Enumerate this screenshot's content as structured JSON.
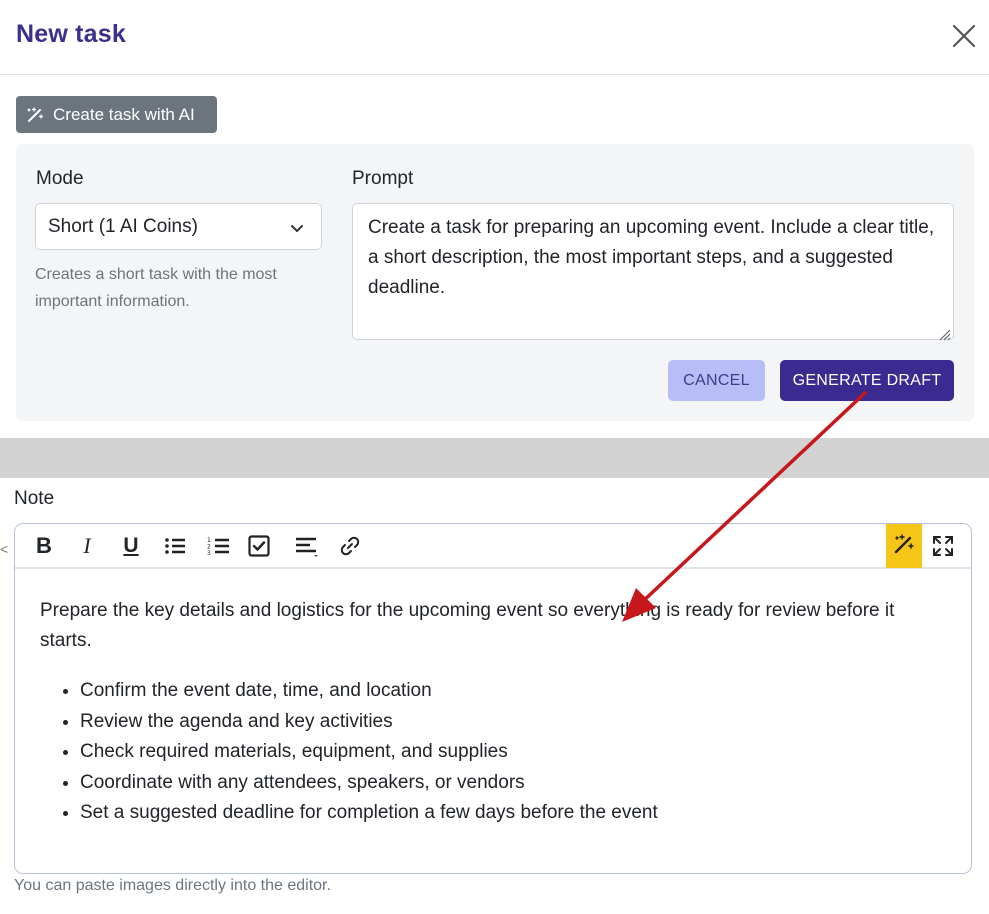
{
  "dialog": {
    "title": "New task",
    "close_icon": "close-icon"
  },
  "ai": {
    "button_label": "Create task with AI",
    "button_icon": "magic-wand-icon",
    "mode_label": "Mode",
    "mode_value": "Short (1 AI Coins)",
    "mode_helper": "Creates a short task with the most important information.",
    "prompt_label": "Prompt",
    "prompt_value": "Create a task for preparing an upcoming event. Include a clear title, a short description, the most important steps, and a suggested deadline.",
    "cancel_label": "CANCEL",
    "generate_label": "GENERATE DRAFT"
  },
  "note": {
    "label": "Note",
    "toolbar": {
      "bold": "B",
      "italic": "I",
      "underline": "U"
    },
    "paragraph": "Prepare the key details and logistics for the upcoming event so everything is ready for review before it starts.",
    "items": [
      "Confirm the event date, time, and location",
      "Review the agenda and key activities",
      "Check required materials, equipment, and supplies",
      "Coordinate with any attendees, speakers, or vendors",
      "Set a suggested deadline for completion a few days before the event"
    ],
    "footer": "You can paste images directly into the editor."
  },
  "colors": {
    "title": "#3b2f8f",
    "primary": "#3b2a8f",
    "cancel_bg": "#b7bdf7",
    "ai_toggle": "#f5c518",
    "annotation_arrow": "#c8171c"
  }
}
